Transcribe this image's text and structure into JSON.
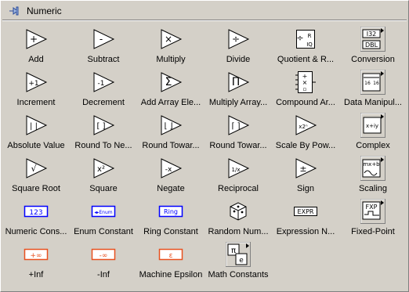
{
  "palette": {
    "title": "Numeric",
    "colors": {
      "background": "#d4d0c8",
      "constant_blue": "#0000ff",
      "constant_orange": "#e8501e"
    }
  },
  "items": [
    {
      "label": "Add",
      "icon": "add-icon"
    },
    {
      "label": "Subtract",
      "icon": "subtract-icon"
    },
    {
      "label": "Multiply",
      "icon": "multiply-icon"
    },
    {
      "label": "Divide",
      "icon": "divide-icon"
    },
    {
      "label": "Quotient & R...",
      "icon": "quotient-remainder-icon"
    },
    {
      "label": "Conversion",
      "icon": "conversion-subpalette-icon"
    },
    {
      "label": "Increment",
      "icon": "increment-icon"
    },
    {
      "label": "Decrement",
      "icon": "decrement-icon"
    },
    {
      "label": "Add Array Ele...",
      "icon": "add-array-elements-icon"
    },
    {
      "label": "Multiply Array...",
      "icon": "multiply-array-elements-icon"
    },
    {
      "label": "Compound Ar...",
      "icon": "compound-arithmetic-icon"
    },
    {
      "label": "Data Manipul...",
      "icon": "data-manipulation-subpalette-icon"
    },
    {
      "label": "Absolute Value",
      "icon": "absolute-value-icon"
    },
    {
      "label": "Round To Ne...",
      "icon": "round-to-nearest-icon"
    },
    {
      "label": "Round Towar...",
      "icon": "round-toward-neg-inf-icon"
    },
    {
      "label": "Round Towar...",
      "icon": "round-toward-pos-inf-icon"
    },
    {
      "label": "Scale By Pow...",
      "icon": "scale-by-power-of-2-icon"
    },
    {
      "label": "Complex",
      "icon": "complex-subpalette-icon"
    },
    {
      "label": "Square Root",
      "icon": "square-root-icon"
    },
    {
      "label": "Square",
      "icon": "square-icon"
    },
    {
      "label": "Negate",
      "icon": "negate-icon"
    },
    {
      "label": "Reciprocal",
      "icon": "reciprocal-icon"
    },
    {
      "label": "Sign",
      "icon": "sign-icon"
    },
    {
      "label": "Scaling",
      "icon": "scaling-subpalette-icon"
    },
    {
      "label": "Numeric Cons...",
      "icon": "numeric-constant-icon"
    },
    {
      "label": "Enum Constant",
      "icon": "enum-constant-icon"
    },
    {
      "label": "Ring Constant",
      "icon": "ring-constant-icon"
    },
    {
      "label": "Random Num...",
      "icon": "random-number-icon"
    },
    {
      "label": "Expression N...",
      "icon": "expression-node-icon"
    },
    {
      "label": "Fixed-Point",
      "icon": "fixed-point-subpalette-icon"
    },
    {
      "label": "+Inf",
      "icon": "positive-infinity-icon"
    },
    {
      "label": "-Inf",
      "icon": "negative-infinity-icon"
    },
    {
      "label": "Machine Epsilon",
      "icon": "machine-epsilon-icon"
    },
    {
      "label": "Math Constants",
      "icon": "math-constants-subpalette-icon"
    }
  ],
  "glyphs": {
    "add": "+",
    "subtract": "-",
    "multiply": "×",
    "divide": "÷",
    "increment": "+1",
    "decrement": "-1",
    "add_array": "Σ",
    "multiply_array": "Π",
    "abs": "| |",
    "round_nearest": "[ ]",
    "round_down": "⌊ ⌋",
    "round_up": "⌈ ⌉",
    "scale_pow": "x2ⁿ",
    "sqrt": "√",
    "square": "x²",
    "negate": "-x",
    "reciprocal": "1/x",
    "sign": "±",
    "numeric_const": "123",
    "enum_const": "◂▸Enum",
    "ring_const": "Ring",
    "expression": "EXPR",
    "pos_inf": "+∞",
    "neg_inf": "-∞",
    "epsilon": "ε",
    "conversion_top": "I32",
    "conversion_bottom": "DBL",
    "data_manip_left": "16",
    "data_manip_right": "16",
    "complex": "x+iy",
    "scaling": "mx+b",
    "fxp": "FXP",
    "math_pi": "π",
    "math_e": "e",
    "quotient_r": "R",
    "quotient_iq": "IQ"
  }
}
